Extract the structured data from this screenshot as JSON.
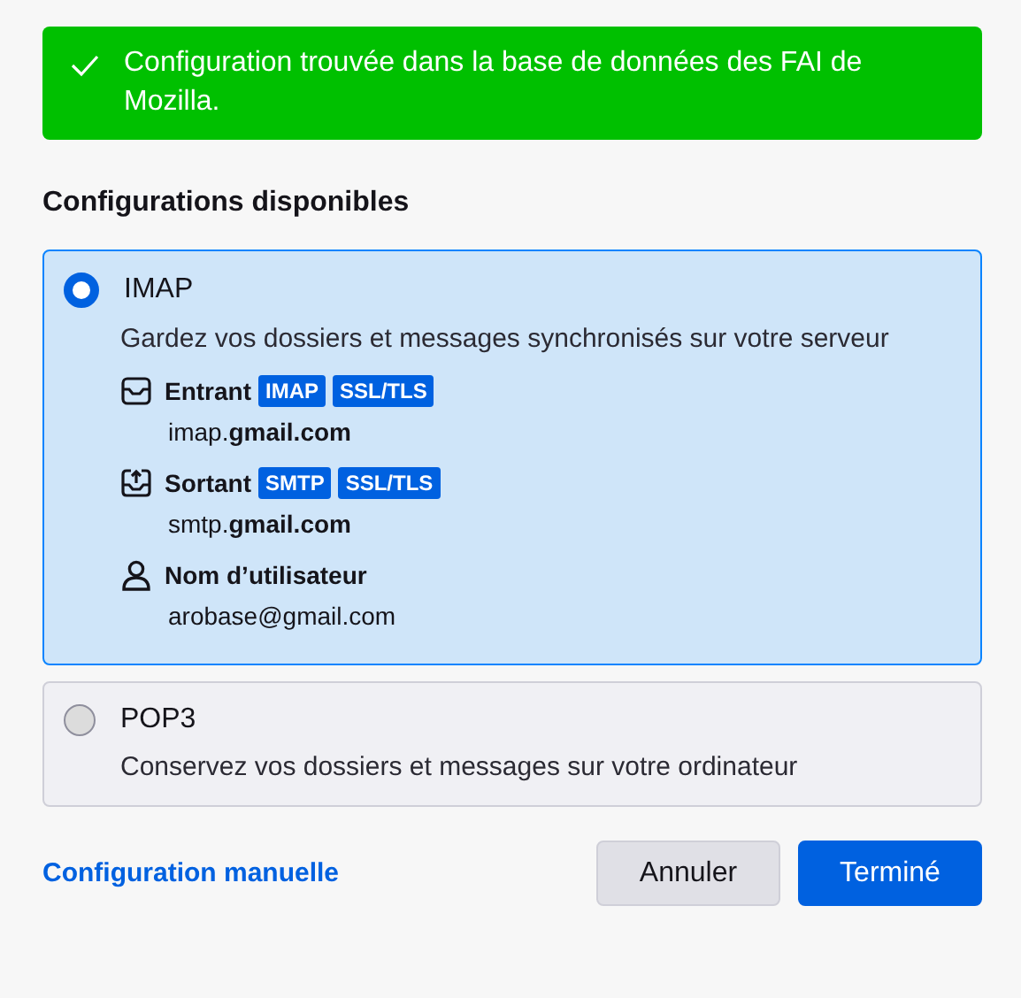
{
  "banner": {
    "text": "Configuration trouvée dans la base de données des FAI de Mozilla."
  },
  "heading": "Configurations disponibles",
  "options": [
    {
      "title": "IMAP",
      "selected": true,
      "description": "Gardez vos dossiers et messages synchronisés sur votre serveur",
      "details": [
        {
          "kind": "incoming",
          "label": "Entrant",
          "tags": [
            "IMAP",
            "SSL/TLS"
          ],
          "value": "imap.**gmail.com**"
        },
        {
          "kind": "outgoing",
          "label": "Sortant",
          "tags": [
            "SMTP",
            "SSL/TLS"
          ],
          "value": "smtp.**gmail.com**"
        },
        {
          "kind": "user",
          "label": "Nom d’utilisateur",
          "value": "arobase@gmail.com"
        }
      ]
    },
    {
      "title": "POP3",
      "selected": false,
      "description": "Conservez vos dossiers et messages sur votre ordinateur"
    }
  ],
  "manual_link": "Configuration manuelle",
  "buttons": [
    {
      "label": "Annuler",
      "kind": "secondary"
    },
    {
      "label": "Terminé",
      "kind": "primary"
    }
  ]
}
